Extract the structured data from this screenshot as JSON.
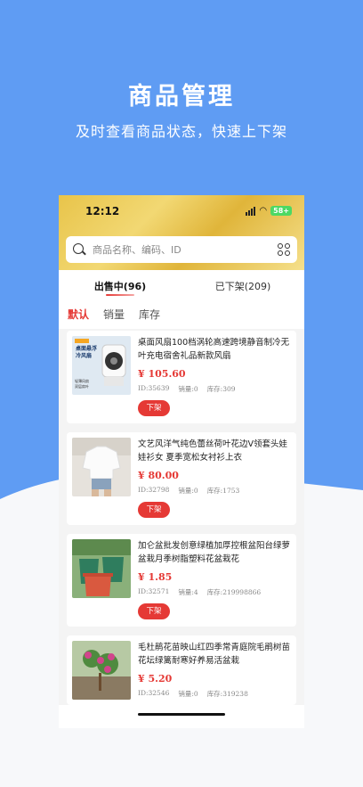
{
  "hero": {
    "title": "商品管理",
    "subtitle": "及时查看商品状态，快速上下架"
  },
  "status_bar": {
    "time": "12:12",
    "battery": "58+"
  },
  "search": {
    "placeholder": "商品名称、编码、ID"
  },
  "tabs": [
    {
      "label": "出售中(96)",
      "active": true
    },
    {
      "label": "已下架(209)",
      "active": false
    }
  ],
  "sorts": [
    {
      "label": "默认",
      "active": true
    },
    {
      "label": "销量",
      "active": false
    },
    {
      "label": "库存",
      "active": false
    }
  ],
  "products": [
    {
      "name": "桌面风扇100档涡轮高速跨境静音制冷无叶充电宿舍礼品新款风扇",
      "price": "¥ 105.60",
      "id": "ID:35639",
      "sales": "销量:0",
      "stock": "库存:309",
      "button": "下架",
      "thumb_text": [
        "桌面悬浮",
        "冷风扇",
        "轻薄风扇",
        "双层扇叶"
      ]
    },
    {
      "name": "文艺风洋气纯色蕾丝荷叶花边V领套头娃娃衫女 夏季宽松女衬衫上衣",
      "price": "¥ 80.00",
      "id": "ID:32798",
      "sales": "销量:0",
      "stock": "库存:1753",
      "button": "下架"
    },
    {
      "name": "加仑盆批发创意绿植加厚控根盆阳台绿萝盆栽月季树脂塑料花盆栽花",
      "price": "¥ 1.85",
      "id": "ID:32571",
      "sales": "销量:4",
      "stock": "库存:219998866",
      "button": "下架"
    },
    {
      "name": "毛杜鹃花苗映山红四季常青庭院毛鹃树苗花坛绿篱耐寒好养易活盆栽",
      "price": "¥ 5.20",
      "id": "ID:32546",
      "sales": "销量:0",
      "stock": "库存:319238",
      "button": "下架"
    }
  ],
  "colors": {
    "background_blue": "#5f9cf3",
    "header_gold": "#e8c44a",
    "accent_red": "#e53935"
  }
}
